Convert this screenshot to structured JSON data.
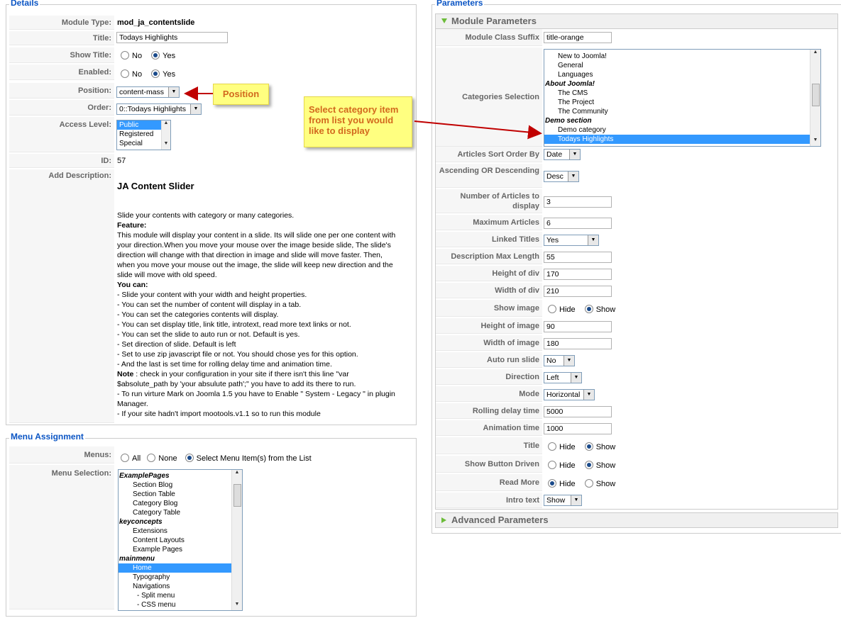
{
  "details": {
    "legend": "Details",
    "module_type_label": "Module Type:",
    "module_type_value": "mod_ja_contentslide",
    "title_label": "Title:",
    "title_value": "Todays Highlights",
    "show_title_label": "Show Title:",
    "enabled_label": "Enabled:",
    "no": "No",
    "yes": "Yes",
    "position_label": "Position:",
    "position_value": "content-mass",
    "order_label": "Order:",
    "order_value": "0::Todays Highlights",
    "access_label": "Access Level:",
    "access_options": [
      "Public",
      "Registered",
      "Special"
    ],
    "id_label": "ID:",
    "id_value": "57",
    "add_desc_label": "Add Description:",
    "desc_title": "JA Content Slider",
    "desc_lines": [
      "Slide your contents with category or many categories.",
      "Feature:",
      "This module will display your content in a slide. Its will slide one per one content with",
      "your direction.When you move your mouse over the image beside slide, The slide's",
      "direction will change with that direction in image and slide will move faster. Then,",
      "when you move your mouse out the image, the slide will keep new direction and the",
      "slide will move with old speed.",
      "You can:",
      "- Slide your content with your width and height properties.",
      "- You can set the number of content will display in a tab.",
      "- You can set the categories contents will display.",
      "- You can set display title, link title, introtext, read more text links or not.",
      "- You can set the slide to auto run or not. Default is yes.",
      "- Set direction of slide. Default is left",
      "- Set to use zip javascript file or not. You should chose yes for this option.",
      "- And the last is set time for rolling delay time and animation time.",
      "Note : check in your configuration in your site if there isn't this line \"var",
      "$absolute_path by 'your absulute path';\" you have to add its there to run.",
      "- To run virture Mark on Joomla 1.5 you have to Enable \" System - Legacy \" in plugin",
      "Manager.",
      "- If your site hadn't import mootools.v1.1 so to run this module"
    ]
  },
  "menu_assignment": {
    "legend": "Menu Assignment",
    "menus_label": "Menus:",
    "opt_all": "All",
    "opt_none": "None",
    "opt_select": "Select Menu Item(s) from the List",
    "selection_label": "Menu Selection:",
    "items": [
      {
        "text": "ExamplePages",
        "kind": "sect"
      },
      {
        "text": "Section Blog",
        "kind": "item"
      },
      {
        "text": "Section Table",
        "kind": "item"
      },
      {
        "text": "Category Blog",
        "kind": "item"
      },
      {
        "text": "Category Table",
        "kind": "item"
      },
      {
        "text": "keyconcepts",
        "kind": "sect"
      },
      {
        "text": "Extensions",
        "kind": "item"
      },
      {
        "text": "Content Layouts",
        "kind": "item"
      },
      {
        "text": "Example Pages",
        "kind": "item"
      },
      {
        "text": "mainmenu",
        "kind": "sect"
      },
      {
        "text": "Home",
        "kind": "hl"
      },
      {
        "text": "Typography",
        "kind": "item"
      },
      {
        "text": "Navigations",
        "kind": "item"
      },
      {
        "text": "- Split menu",
        "kind": "sub"
      },
      {
        "text": "- CSS menu",
        "kind": "sub"
      }
    ]
  },
  "parameters": {
    "legend": "Parameters",
    "module_params_title": "Module Parameters",
    "advanced_params_title": "Advanced Parameters",
    "suffix_label": "Module Class Suffix",
    "suffix_value": "title-orange",
    "categories_label": "Categories Selection",
    "categories": [
      {
        "text": "New to Joomla!",
        "kind": "item"
      },
      {
        "text": "General",
        "kind": "item"
      },
      {
        "text": "Languages",
        "kind": "item"
      },
      {
        "text": "About Joomla!",
        "kind": "sect"
      },
      {
        "text": "The CMS",
        "kind": "item"
      },
      {
        "text": "The Project",
        "kind": "item"
      },
      {
        "text": "The Community",
        "kind": "item"
      },
      {
        "text": "Demo section",
        "kind": "sect"
      },
      {
        "text": "Demo category",
        "kind": "item"
      },
      {
        "text": "Todays Highlights",
        "kind": "hl"
      }
    ],
    "sort_label": "Articles Sort Order By",
    "sort_value": "Date",
    "asc_label": "Ascending OR Descending",
    "asc_value": "Desc",
    "num_label": "Number of Articles to display",
    "num_value": "3",
    "max_label": "Maximum Articles",
    "max_value": "6",
    "linked_label": "Linked Titles",
    "linked_value": "Yes",
    "desc_len_label": "Description Max Length",
    "desc_len_value": "55",
    "hdiv_label": "Height of div",
    "hdiv_value": "170",
    "wdiv_label": "Width of div",
    "wdiv_value": "210",
    "showimg_label": "Show image",
    "himg_label": "Height of image",
    "himg_value": "90",
    "wimg_label": "Width of image",
    "wimg_value": "180",
    "autorun_label": "Auto run slide",
    "autorun_value": "No",
    "dir_label": "Direction",
    "dir_value": "Left",
    "mode_label": "Mode",
    "mode_value": "Horizontal",
    "rolling_label": "Rolling delay time",
    "rolling_value": "5000",
    "anim_label": "Animation time",
    "anim_value": "1000",
    "title_label": "Title",
    "sbd_label": "Show Button Driven",
    "readmore_label": "Read More",
    "intro_label": "Intro text",
    "intro_value": "Show",
    "hide": "Hide",
    "show": "Show"
  },
  "callouts": {
    "position": "Position",
    "category": "Select category item from list you would like to display"
  },
  "colors": {
    "legend": "#0B55C4",
    "highlight": "#3399ff",
    "callout_bg": "#ffff80",
    "callout_text": "#d2691e",
    "arrow": "#c00000"
  }
}
